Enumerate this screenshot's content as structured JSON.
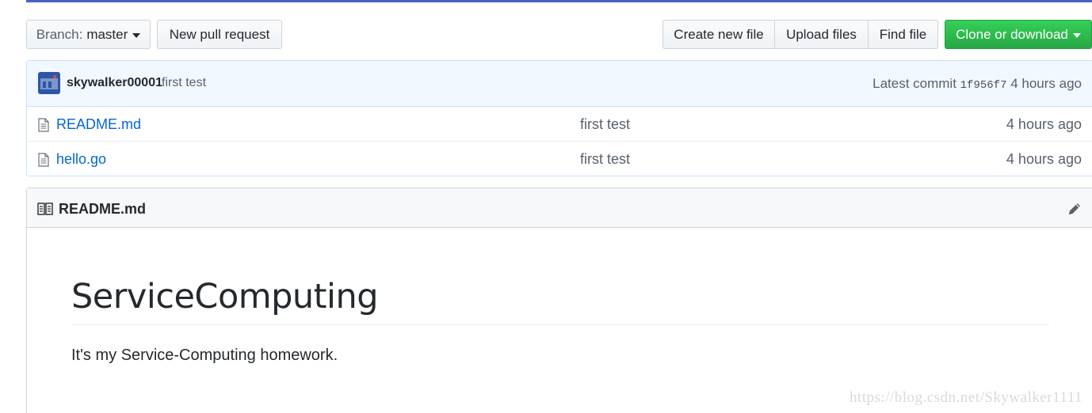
{
  "toolbar": {
    "branch_prefix": "Branch:",
    "branch_name": "master",
    "new_pr": "New pull request",
    "create_file": "Create new file",
    "upload_files": "Upload files",
    "find_file": "Find file",
    "clone": "Clone or download"
  },
  "commit": {
    "author": "skywalker00001",
    "message": "first test",
    "latest_label": "Latest commit",
    "sha": "1f956f7",
    "age": "4 hours ago"
  },
  "files": [
    {
      "name": "README.md",
      "message": "first test",
      "age": "4 hours ago",
      "icon": "file-icon"
    },
    {
      "name": "hello.go",
      "message": "first test",
      "age": "4 hours ago",
      "icon": "file-icon"
    }
  ],
  "readme": {
    "filename": "README.md",
    "heading": "ServiceComputing",
    "paragraph": "It's my Service-Computing homework."
  },
  "watermark": "https://blog.csdn.net/Skywalker1111",
  "colors": {
    "link": "#0366d6",
    "clone_button": "#28a745",
    "commit_bar": "#f1f8ff",
    "top_line": "#4a5fbf"
  }
}
